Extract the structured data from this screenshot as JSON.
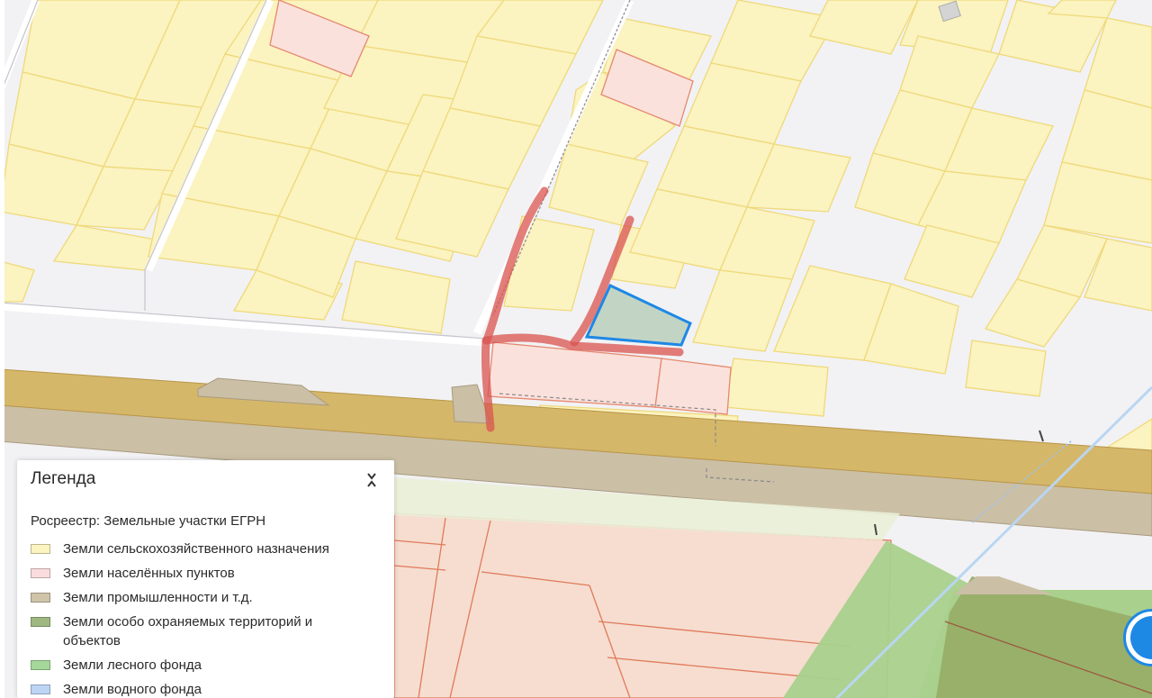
{
  "legend": {
    "title": "Легенда",
    "collapse_icon": "chevron-collapse-icon",
    "subtitle": "Росреестр: Земельные участки ЕГРН",
    "items": [
      {
        "label": "Земли сельскохозяйственного назначения",
        "color": "#fbf3c0"
      },
      {
        "label": "Земли населённых пунктов",
        "color": "#fbdcdc"
      },
      {
        "label": "Земли промышленности и т.д.",
        "color": "#cfc3a8"
      },
      {
        "label": "Земли особо охраняемых территорий и объектов",
        "color": "#9fb882"
      },
      {
        "label": "Земли лесного фонда",
        "color": "#a6d79a"
      },
      {
        "label": "Земли водного фонда",
        "color": "#bcd5f5"
      }
    ]
  },
  "colors": {
    "agricultural_fill": "#fbf3c0",
    "agricultural_stroke": "#efd97a",
    "settlement_fill": "#fbe1dc",
    "settlement_stroke": "#e4896f",
    "industrial_fill": "#cbbfa6",
    "road_fill": "#d5b76a",
    "protected_fill": "#98b06a",
    "forest_fill": "#a9d08c",
    "selected_outline": "#1e88e5",
    "route": "#d9534f"
  },
  "chat_button_icon": "chat-icon"
}
